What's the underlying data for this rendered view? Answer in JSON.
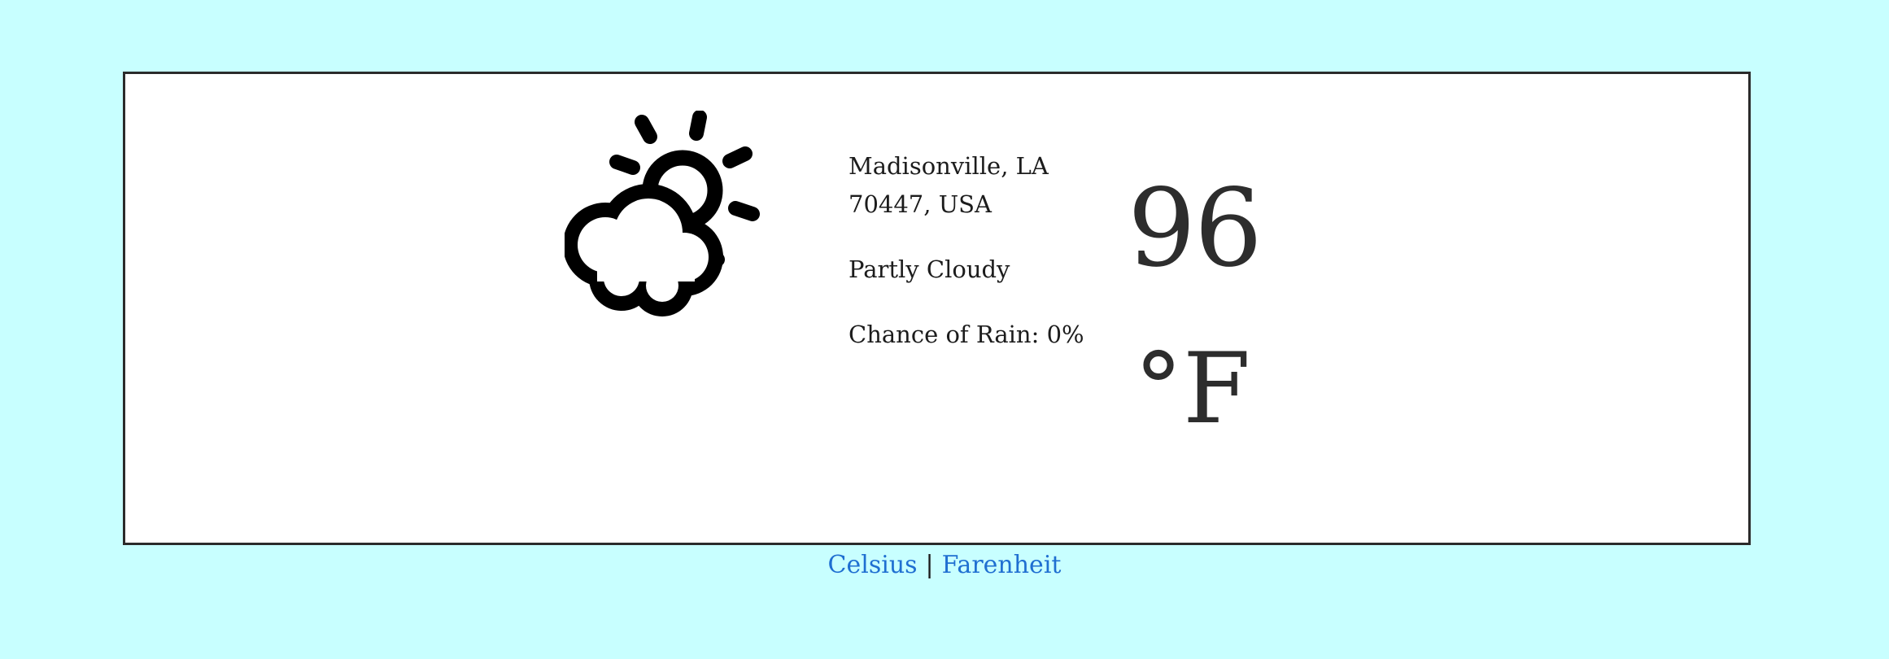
{
  "weather": {
    "icon": "partly-cloudy-icon",
    "location_line1": "Madisonville, LA",
    "location_line2": "70447, USA",
    "condition": "Partly Cloudy",
    "rain": "Chance of Rain: 0%",
    "temperature": "96",
    "unit": "°F"
  },
  "units_toggle": {
    "celsius_label": "Celsius",
    "separator": "|",
    "fahrenheit_label": "Farenheit"
  },
  "colors": {
    "page_background": "#c8ffff",
    "card_background": "#ffffff",
    "link": "#1f6fd1"
  }
}
